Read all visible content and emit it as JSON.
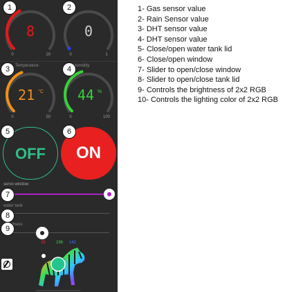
{
  "gauges": [
    {
      "value": "8",
      "min": "0",
      "max": "20",
      "fraction": 0.4,
      "color": "#e81818",
      "label": ""
    },
    {
      "value": "0",
      "min": "0",
      "max": "1",
      "fraction": 0.0,
      "color": "#2a3cff",
      "label": ""
    },
    {
      "value": "21",
      "unit": "°C",
      "min": "0",
      "max": "50",
      "fraction": 0.42,
      "color": "#f0901a",
      "label": "Temperature"
    },
    {
      "value": "44",
      "unit": "%",
      "min": "0",
      "max": "100",
      "fraction": 0.44,
      "color": "#39d13c",
      "label": "Humidity"
    }
  ],
  "buttons": {
    "off": "OFF",
    "on": "ON"
  },
  "sliders": {
    "window_label": "servo window",
    "window_value": 1.0,
    "tank_label": "water tank",
    "brightness_label": "brightness",
    "brightness_value": 0.35
  },
  "rgb": {
    "r": "35",
    "g": "196",
    "b": "142"
  },
  "numbers": [
    "1",
    "2",
    "3",
    "4",
    "5",
    "6",
    "7",
    "8",
    "9",
    "10"
  ],
  "legend": [
    "1- Gas sensor value",
    "2- Rain Sensor value",
    "3- DHT sensor value",
    "4- DHT sensor value",
    "5- Close/open water tank lid",
    "6- Close/open window",
    "7- Slider to open/close window",
    "8- Slider to open/close tank lid",
    "9- Controls the brightness of 2x2 RGB",
    "10- Controls the lighting color of 2x2 RGB"
  ],
  "colors": {
    "accent": "#b01ec8",
    "on": "#e82020",
    "off": "#2fbf8a"
  }
}
